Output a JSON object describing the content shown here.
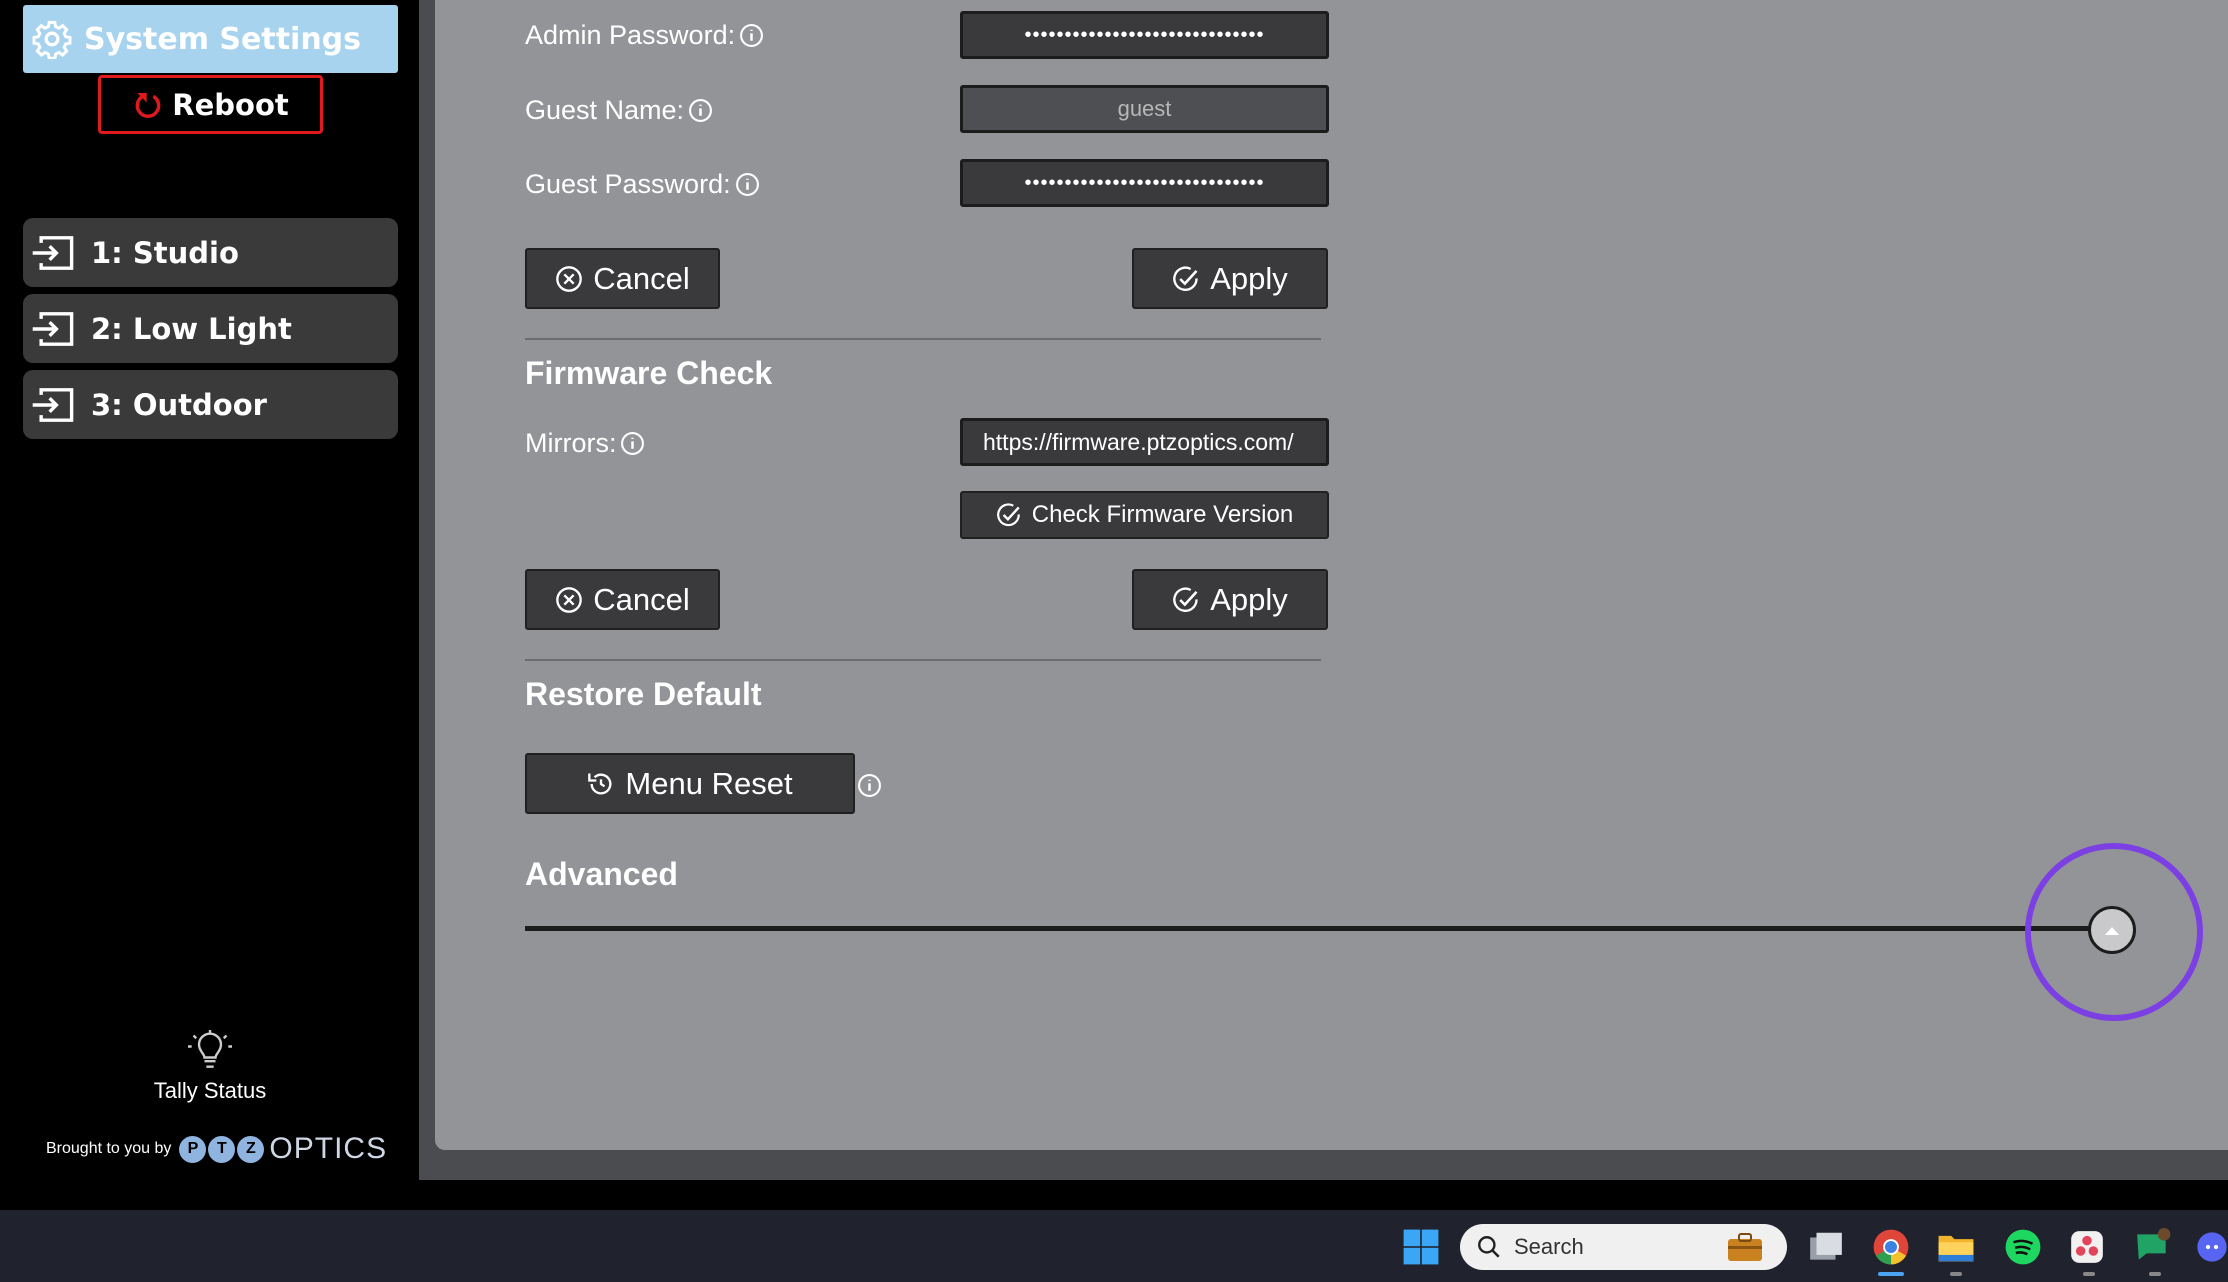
{
  "sidebar": {
    "system_settings_label": "System Settings",
    "reboot_label": "Reboot",
    "presets": [
      {
        "label": "1: Studio"
      },
      {
        "label": "2: Low Light"
      },
      {
        "label": "3: Outdoor"
      }
    ],
    "tally_label": "Tally Status",
    "brought_by": "Brought to you by",
    "brand_word": "OPTICS",
    "brand_letters": [
      "P",
      "T",
      "Z"
    ]
  },
  "account": {
    "admin_password_label": "Admin Password:",
    "admin_password_value": "••••••••••••••••••••••••••••••",
    "guest_name_label": "Guest Name:",
    "guest_name_value": "guest",
    "guest_password_label": "Guest Password:",
    "guest_password_value": "••••••••••••••••••••••••••••••",
    "cancel_label": "Cancel",
    "apply_label": "Apply"
  },
  "firmware": {
    "heading": "Firmware Check",
    "mirrors_label": "Mirrors:",
    "mirrors_value": "https://firmware.ptzoptics.com/",
    "check_label": "Check Firmware Version",
    "cancel_label": "Cancel",
    "apply_label": "Apply"
  },
  "restore": {
    "heading": "Restore Default",
    "menu_reset_label": "Menu Reset"
  },
  "advanced": {
    "heading": "Advanced"
  },
  "taskbar": {
    "search_placeholder": "Search"
  },
  "colors": {
    "accent": "#a7d3ef",
    "reboot_border": "#e0191d",
    "panel": "#939497",
    "button": "#3a3a3c",
    "scroll_ring": "#7b3fe4"
  }
}
